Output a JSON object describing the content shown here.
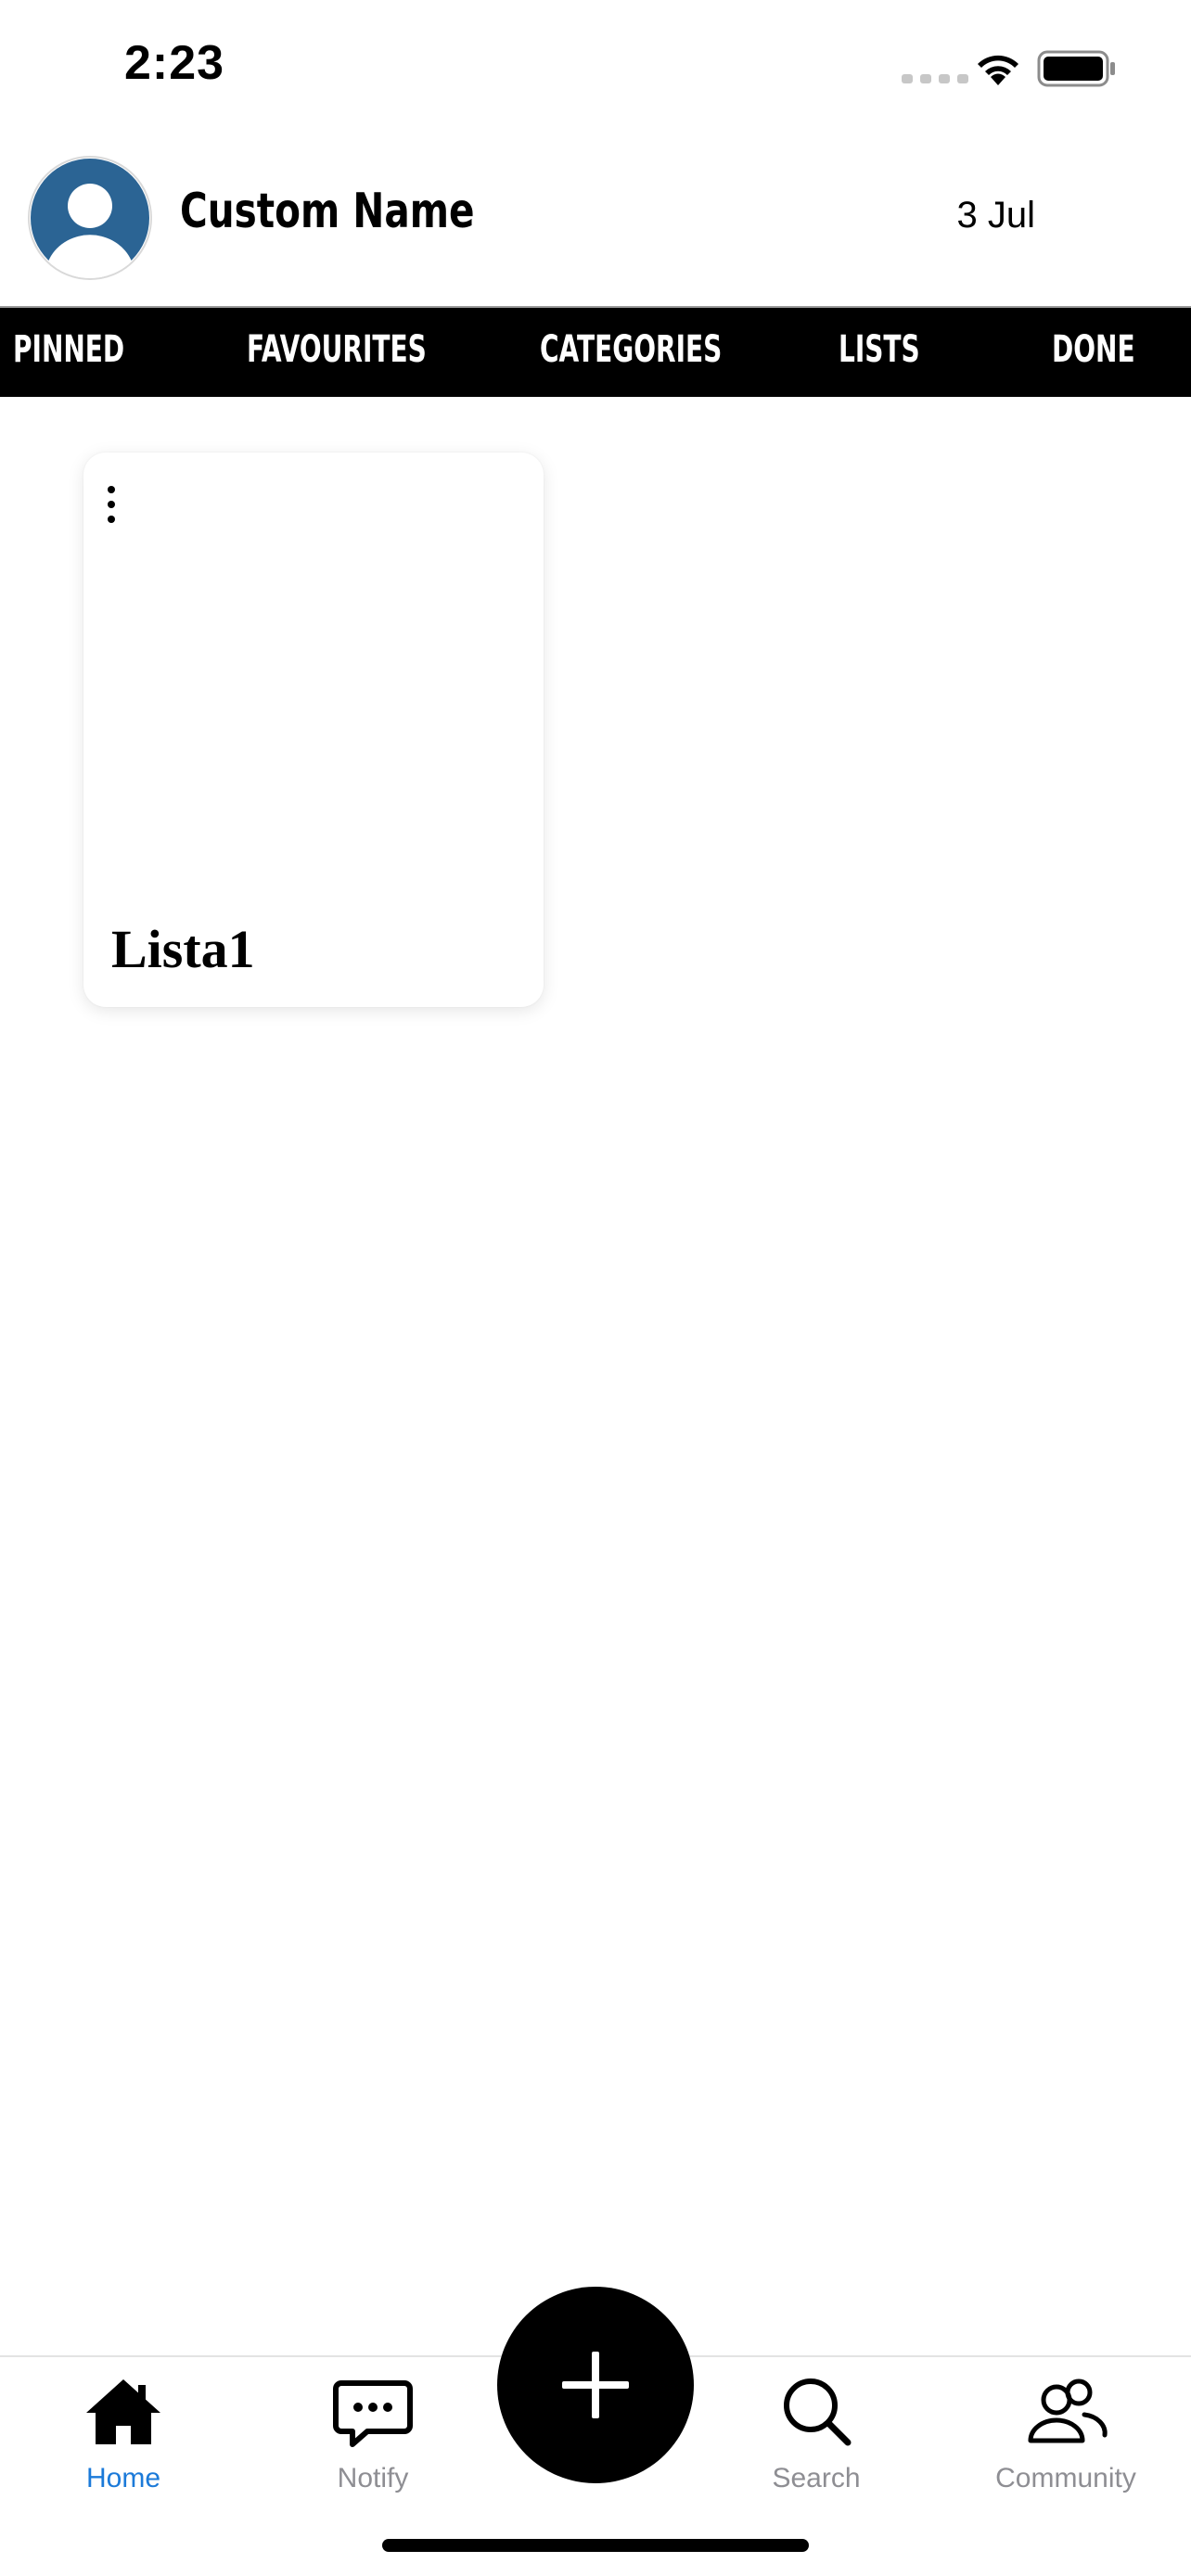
{
  "status_bar": {
    "time": "2:23"
  },
  "header": {
    "user_name": "Custom Name",
    "date": "3 Jul"
  },
  "tabs": [
    {
      "label": "PINNED"
    },
    {
      "label": "FAVOURITES"
    },
    {
      "label": "CATEGORIES"
    },
    {
      "label": "LISTS"
    },
    {
      "label": "DONE"
    }
  ],
  "cards": [
    {
      "title": "Lista1"
    }
  ],
  "bottom_nav": {
    "items": [
      {
        "label": "Home",
        "icon": "home-icon",
        "active": true
      },
      {
        "label": "Notify",
        "icon": "chat-bubble-icon",
        "active": false
      },
      {
        "label": "Search",
        "icon": "search-icon",
        "active": false
      },
      {
        "label": "Community",
        "icon": "people-icon",
        "active": false
      }
    ],
    "fab_icon": "plus-icon"
  },
  "colors": {
    "active_nav": "#1b7ad9",
    "inactive_nav": "#8e8e93",
    "tab_bar_bg": "#000000",
    "avatar_blue": "#2b6494"
  }
}
